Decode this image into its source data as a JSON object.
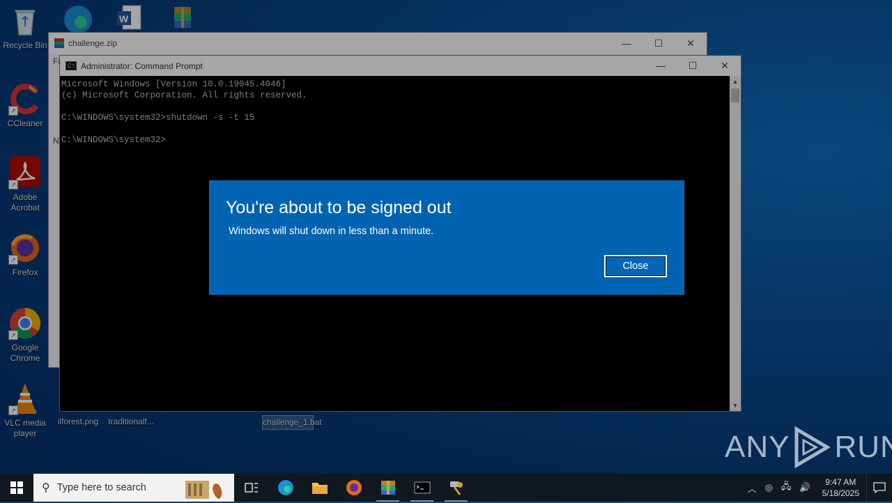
{
  "desktop": {
    "icons": [
      {
        "label": "Recycle Bin",
        "icon": "recycle-bin-icon"
      },
      {
        "label": "CCleaner",
        "icon": "ccleaner-icon"
      },
      {
        "label": "Adobe Acrobat",
        "icon": "adobe-acrobat-icon"
      },
      {
        "label": "Firefox",
        "icon": "firefox-icon"
      },
      {
        "label": "Google Chrome",
        "icon": "chrome-icon"
      },
      {
        "label": "VLC media player",
        "icon": "vlc-icon"
      },
      {
        "label": "ilforest.png",
        "icon": "image-file-icon"
      },
      {
        "label": "traditionalf...",
        "icon": "image-file-icon"
      },
      {
        "label": "challenge_1.bat",
        "icon": "batch-file-icon"
      }
    ]
  },
  "explorer_window": {
    "title": "challenge.zip",
    "menu_fragment": "Fi",
    "list_fragment": "N"
  },
  "cmd_window": {
    "title": "Administrator: Command Prompt",
    "lines": [
      "Microsoft Windows [Version 10.0.19045.4046]",
      "(c) Microsoft Corporation. All rights reserved.",
      "",
      "C:\\WINDOWS\\system32>shutdown -s -t 15",
      "",
      "C:\\WINDOWS\\system32>"
    ]
  },
  "dialog": {
    "title": "You're about to be signed out",
    "message": "Windows will shut down in less than a minute.",
    "close_label": "Close",
    "color": "#0063b1"
  },
  "watermark": {
    "left": "ANY",
    "right": "RUN"
  },
  "taskbar": {
    "search_placeholder": "Type here to search",
    "clock_time": "9:47 AM",
    "clock_date": "5/18/2025",
    "apps": [
      "task-view-icon",
      "edge-icon",
      "file-explorer-icon",
      "firefox-icon",
      "winrar-icon",
      "command-prompt-icon",
      "key-tool-icon"
    ]
  }
}
